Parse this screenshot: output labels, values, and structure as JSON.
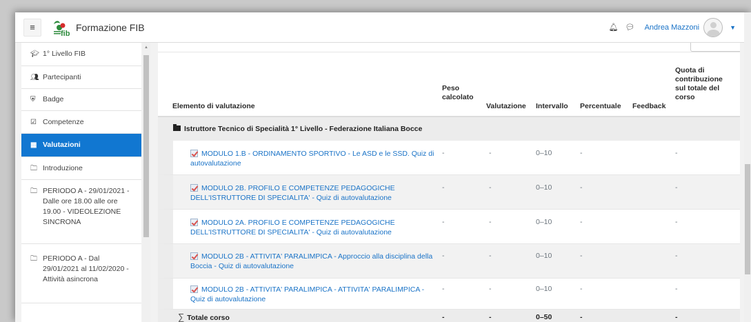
{
  "app": {
    "brand": "Formazione FIB",
    "user_name": "Andrea Mazzoni"
  },
  "sidebar": {
    "items": [
      {
        "label": "1° Livello FIB",
        "icon": "graduation-cap-icon",
        "glyph": "🎓"
      },
      {
        "label": "Partecipanti",
        "icon": "users-icon",
        "glyph": "👥"
      },
      {
        "label": "Badge",
        "icon": "shield-icon",
        "glyph": "⛨"
      },
      {
        "label": "Competenze",
        "icon": "checkbox-icon",
        "glyph": "☑"
      },
      {
        "label": "Valutazioni",
        "icon": "table-icon",
        "glyph": "▦"
      },
      {
        "label": "Introduzione",
        "icon": "folder-icon",
        "glyph": "🗀"
      },
      {
        "label": "PERIODO A - 29/01/2021 - Dalle ore 18.00 alle ore 19.00 - VIDEOLEZIONE SINCRONA",
        "icon": "folder-icon",
        "glyph": "🗀"
      },
      {
        "label": "PERIODO A - Dal 29/01/2021 al 11/02/2020 - Attività asincrona",
        "icon": "folder-icon",
        "glyph": "🗀"
      }
    ],
    "active_index": 4
  },
  "table": {
    "headers": {
      "item": "Elemento di valutazione",
      "peso": "Peso calcolato",
      "valutazione": "Valutazione",
      "intervallo": "Intervallo",
      "percentuale": "Percentuale",
      "feedback": "Feedback",
      "quota": "Quota di contribuzione sul totale del corso"
    },
    "category": "Istruttore Tecnico di Specialità 1° Livello - Federazione Italiana Bocce",
    "rows": [
      {
        "name": "MODULO 1.B - ORDINAMENTO SPORTIVO - Le ASD e le SSD. Quiz di autovalutazione",
        "peso": "-",
        "valutazione": "-",
        "intervallo": "0–10",
        "percentuale": "-",
        "feedback": "",
        "quota": "-"
      },
      {
        "name": "MODULO 2B. PROFILO E COMPETENZE PEDAGOGICHE DELL'ISTRUTTORE DI SPECIALITA' - Quiz di autovalutazione",
        "peso": "-",
        "valutazione": "-",
        "intervallo": "0–10",
        "percentuale": "-",
        "feedback": "",
        "quota": "-"
      },
      {
        "name": "MODULO 2A. PROFILO E COMPETENZE PEDAGOGICHE DELL'ISTRUTTORE DI SPECIALITA' - Quiz di autovalutazione",
        "peso": "-",
        "valutazione": "-",
        "intervallo": "0–10",
        "percentuale": "-",
        "feedback": "",
        "quota": "-"
      },
      {
        "name": "MODULO 2B - ATTIVITA' PARALIMPICA - Approccio alla disciplina della Boccia - Quiz di autovalutazione",
        "peso": "-",
        "valutazione": "-",
        "intervallo": "0–10",
        "percentuale": "-",
        "feedback": "",
        "quota": "-"
      },
      {
        "name": "MODULO 2B - ATTIVITA' PARALIMPICA - ATTIVITA' PARALIMPICA - Quiz di autovalutazione",
        "peso": "-",
        "valutazione": "-",
        "intervallo": "0–10",
        "percentuale": "-",
        "feedback": "",
        "quota": "-"
      }
    ],
    "total": {
      "label": "Totale corso",
      "peso": "-",
      "valutazione": "-",
      "intervallo": "0–50",
      "percentuale": "-",
      "quota": "-"
    }
  },
  "colors": {
    "accent": "#1177d1",
    "link": "#1a73c7"
  }
}
